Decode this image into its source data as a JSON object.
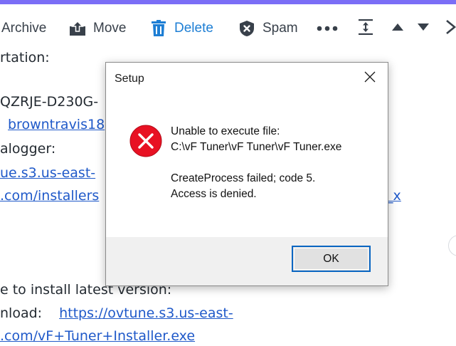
{
  "toolbar": {
    "archive_label": "Archive",
    "move_label": "Move",
    "delete_label": "Delete",
    "spam_label": "Spam"
  },
  "email": {
    "line1": "rtation:",
    "line2": "QZRJE-D230G-",
    "line3_link": "browntravis18",
    "line4": "alogger:",
    "line5_link": "ue.s3.us-east-",
    "line6_link_a": ".com/installers",
    "line6_link_b": "_x",
    "line7": "e to install latest version:",
    "line8_text": "nload:",
    "line8_link": "https://ovtune.s3.us-east-",
    "line9_link": ".com/vF+Tuner+Installer.exe"
  },
  "dialog": {
    "title": "Setup",
    "message_line1": "Unable to execute file:",
    "message_line2": "C:\\vF Tuner\\vF Tuner\\vF Tuner.exe",
    "message_line3": "CreateProcess failed; code 5.",
    "message_line4": "Access is denied.",
    "ok_label": "OK"
  },
  "colors": {
    "accent_bar": "#7b6ef6",
    "delete_blue": "#1d7ed4",
    "link_blue": "#1f59c9",
    "error_red": "#e81123",
    "focus_border": "#0a66c2"
  },
  "icons": {
    "archive": "archive-icon",
    "move": "move-icon",
    "delete": "trash-icon",
    "spam": "shield-icon",
    "more": "more-icon",
    "collapse": "collapse-icon",
    "prev": "chevron-up-icon",
    "next": "chevron-down-icon",
    "close": "close-icon",
    "error": "error-icon"
  }
}
